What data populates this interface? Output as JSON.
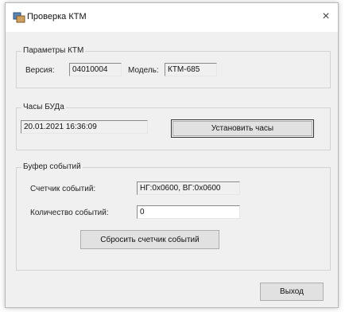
{
  "window": {
    "title": "Проверка КТМ",
    "close_icon": "×"
  },
  "params_group": {
    "label": "Параметры КТМ",
    "version_label": "Версия:",
    "version_value": "04010004",
    "model_label": "Модель:",
    "model_value": "КТМ-685"
  },
  "clock_group": {
    "label": "Часы БУДа",
    "datetime_value": "20.01.2021 16:36:09",
    "set_clock_label": "Установить часы"
  },
  "buffer_group": {
    "label": "Буфер событий",
    "counter_label": "Счетчик событий:",
    "counter_value": "НГ:0x0600,  ВГ:0x0600",
    "count_label": "Количество событий:",
    "count_value": "0",
    "reset_label": "Сбросить счетчик событий"
  },
  "footer": {
    "exit_label": "Выход"
  }
}
